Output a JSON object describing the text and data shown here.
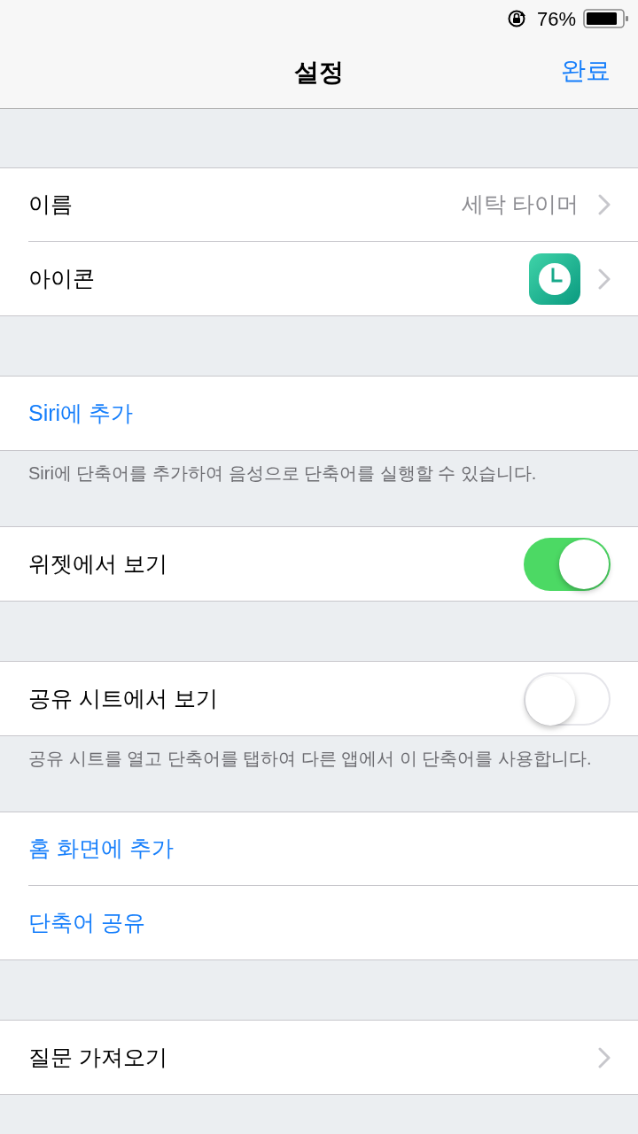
{
  "status_bar": {
    "battery": "76%"
  },
  "nav_bar": {
    "title": "설정",
    "done": "완료"
  },
  "sections": [
    {
      "rows": [
        {
          "kind": "detail",
          "label": "이름",
          "value": "세탁 타이머"
        },
        {
          "kind": "icon",
          "label": "아이콘"
        }
      ]
    },
    {
      "rows": [
        {
          "kind": "action",
          "label": "Siri에 추가"
        }
      ],
      "footer": "Siri에 단축어를 추가하여 음성으로 단축어를 실행할 수 있습니다."
    },
    {
      "rows": [
        {
          "kind": "toggle",
          "label": "위젯에서 보기",
          "on": true
        }
      ]
    },
    {
      "rows": [
        {
          "kind": "toggle",
          "label": "공유 시트에서 보기",
          "on": false
        }
      ],
      "footer": "공유 시트를 열고 단축어를 탭하여 다른 앱에서 이 단축어를 사용합니다."
    },
    {
      "rows": [
        {
          "kind": "action",
          "label": "홈 화면에 추가"
        },
        {
          "kind": "action",
          "label": "단축어 공유"
        }
      ]
    },
    {
      "rows": [
        {
          "kind": "chevron",
          "label": "질문 가져오기"
        }
      ]
    }
  ]
}
